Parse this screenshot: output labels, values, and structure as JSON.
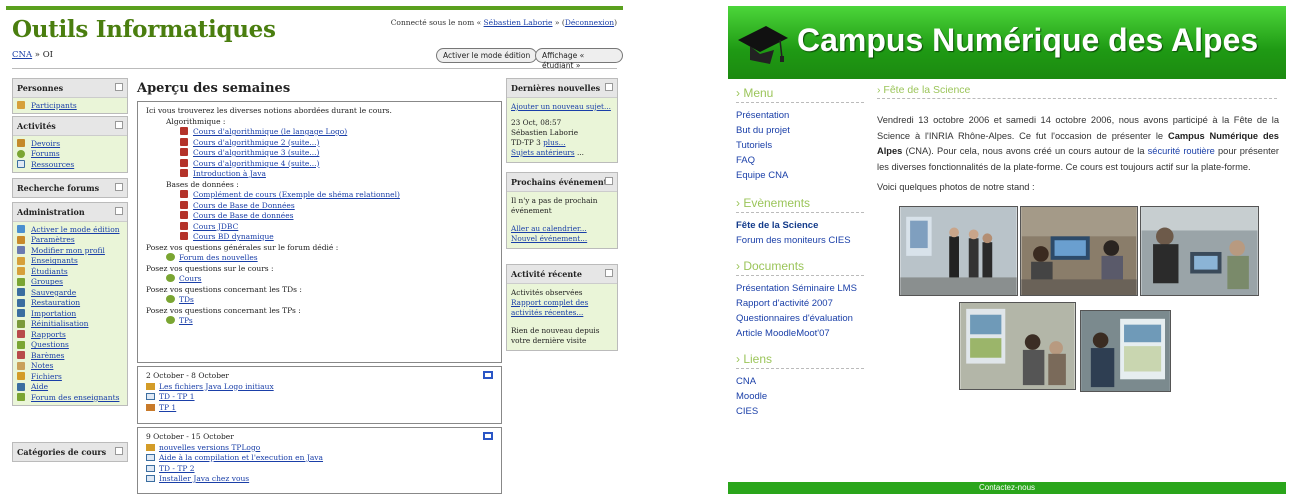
{
  "moodle": {
    "title": "Outils Informatiques",
    "login": {
      "prefix": "Connecté sous le nom «",
      "user": "Sébastien Laborie",
      "middle": "» (",
      "logout": "Déconnexion",
      "suffix": ")"
    },
    "breadcrumb": {
      "home": "CNA",
      "sep": "» OI"
    },
    "buttons": {
      "edit": "Activer le mode édition",
      "student": "Affichage « étudiant »"
    },
    "left_blocks": {
      "personnes": {
        "title": "Personnes",
        "items": [
          "Participants"
        ]
      },
      "activites": {
        "title": "Activités",
        "items": [
          "Devoirs",
          "Forums",
          "Ressources"
        ]
      },
      "recherche": {
        "title": "Recherche forums"
      },
      "administration": {
        "title": "Administration",
        "items": [
          "Activer le mode édition",
          "Paramètres",
          "Modifier mon profil",
          "Enseignants",
          "Étudiants",
          "Groupes",
          "Sauvegarde",
          "Restauration",
          "Importation",
          "Réinitialisation",
          "Rapports",
          "Questions",
          "Barèmes",
          "Notes",
          "Fichiers",
          "Aide",
          "Forum des enseignants"
        ]
      },
      "categories": {
        "title": "Catégories de cours"
      }
    },
    "center": {
      "title": "Aperçu des semaines",
      "topic0": {
        "intro": "Ici vous trouverez les diverses notions abordées durant le cours.",
        "algo_label": "Algorithmique :",
        "algo_items": [
          "Cours d'algorithmique (le langage Logo)",
          "Cours d'algorithmique 2 (suite...)",
          "Cours d'algorithmique 3 (suite...)",
          "Cours d'algorithmique 4 (suite...)",
          "Introduction à Java"
        ],
        "bd_label": "Bases de données :",
        "bd_items": [
          "Complément de cours (Exemple de shéma relationnel)",
          "Cours de Base de Données",
          "Cours de Base de données",
          "Cours JDBC",
          "Cours BD dynamique"
        ],
        "q1": "Posez vos questions générales sur le forum dédié :",
        "f1": "Forum des nouvelles",
        "q2": "Posez vos questions sur le cours :",
        "f2": "Cours",
        "q3": "Posez vos questions concernant les TDs :",
        "f3": "TDs",
        "q4": "Posez vos questions concernant les TPs :",
        "f4": "TPs"
      },
      "week1": {
        "dates": "2 October - 8 October",
        "items": [
          "Les fichiers Java Logo initiaux",
          "TD - TP 1",
          "TP 1"
        ]
      },
      "week2": {
        "dates": "9 October - 15 October",
        "items": [
          "nouvelles versions TPLogo",
          "Aide à la compilation et l'execution en Java",
          "TD - TP 2",
          "Installer Java chez vous"
        ]
      }
    },
    "right_blocks": {
      "news": {
        "title": "Dernières nouvelles",
        "add": "Ajouter un nouveau sujet...",
        "date": "23 Oct, 08:57",
        "author": "Sébastien Laborie",
        "subject": "TD-TP 3",
        "more": "plus...",
        "older": "Sujets antérieurs",
        "older_suffix": " ..."
      },
      "events": {
        "title": "Prochains événements",
        "none": "Il n'y a pas de prochain événement",
        "calendar": "Aller au calendrier...",
        "new": "Nouvel événement..."
      },
      "recent": {
        "title": "Activité récente",
        "observed": "Activités observées",
        "report": "Rapport complet des activités récentes...",
        "nothing": "Rien de nouveau depuis votre dernière visite"
      }
    }
  },
  "campus": {
    "title": "Campus Numérique des Alpes",
    "menu": {
      "title": "› Menu",
      "items": [
        "Présentation",
        "But du projet",
        "Tutoriels",
        "FAQ",
        "Equipe CNA"
      ]
    },
    "events": {
      "title": "› Evènements",
      "items": [
        "Fête de la Science",
        "Forum des moniteurs CIES"
      ]
    },
    "documents": {
      "title": "› Documents",
      "items": [
        "Présentation Séminaire LMS",
        "Rapport d'activité 2007",
        "Questionnaires d'évaluation",
        "Article MoodleMoot'07"
      ]
    },
    "links": {
      "title": "› Liens",
      "items": [
        "CNA",
        "Moodle",
        "CIES"
      ]
    },
    "main": {
      "title": "› Fête de la Science",
      "p1": "Vendredi 13 octobre 2006 et samedi 14 octobre 2006, nous avons participé à la Fête de la Science à l'INRIA Rhône-Alpes. Ce fut l'occasion de présenter le",
      "p1_bold": "Campus Numérique des Alpes",
      "p1b": "(CNA). Pour cela, nous avons créé un cours autour de la",
      "p1_link": "sécurité routière",
      "p1c": "pour présenter les diverses fonctionnalités de la plate-forme. Ce cours est toujours actif sur la plate-forme.",
      "photos_label": "Voici quelques photos de notre stand :"
    },
    "footer": "Contactez-nous"
  }
}
